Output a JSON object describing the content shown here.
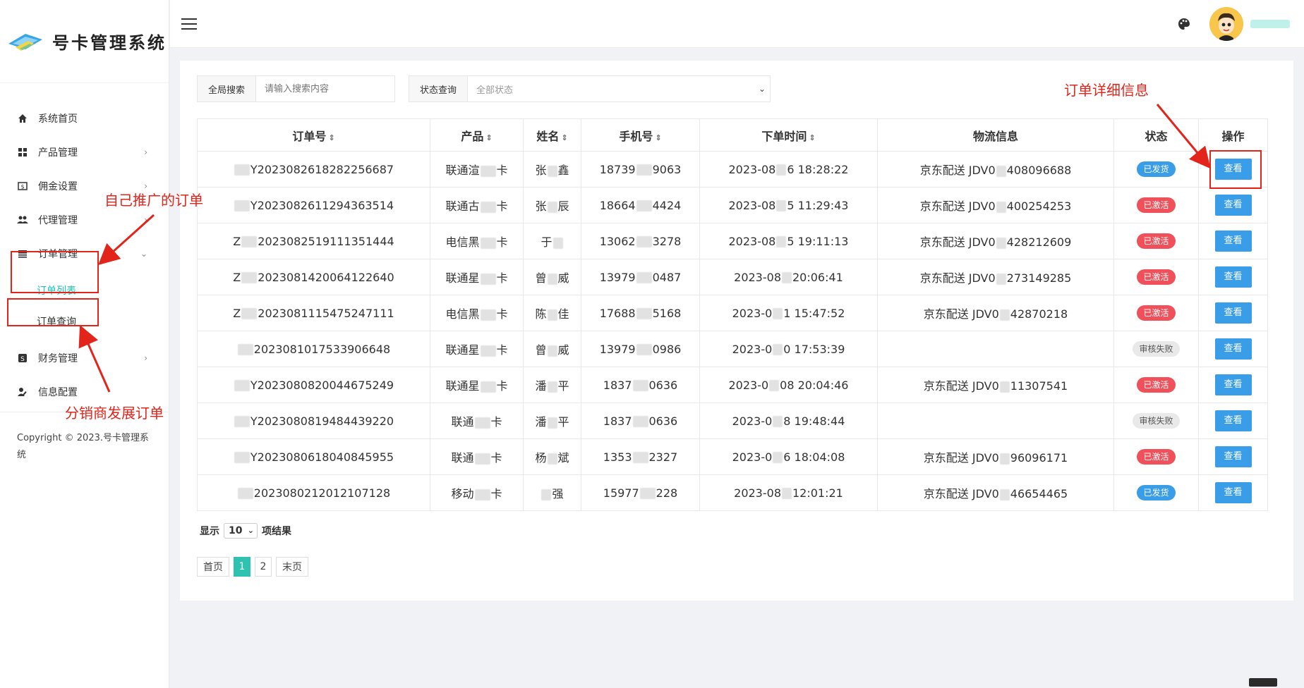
{
  "brand": {
    "title": "号卡管理系统"
  },
  "sidebar": {
    "items": [
      {
        "label": "系统首页",
        "icon": "home-icon"
      },
      {
        "label": "产品管理",
        "icon": "grid-icon"
      },
      {
        "label": "佣金设置",
        "icon": "dollar-icon"
      },
      {
        "label": "代理管理",
        "icon": "users-icon"
      },
      {
        "label": "订单管理",
        "icon": "list-icon"
      },
      {
        "label": "财务管理",
        "icon": "finance-icon"
      },
      {
        "label": "信息配置",
        "icon": "user-edit-icon"
      }
    ],
    "sub_items": [
      {
        "label": "订单列表",
        "active": true
      },
      {
        "label": "订单查询",
        "active": false
      }
    ],
    "copyright": "Copyright © 2023.号卡管理系统"
  },
  "filters": {
    "search_label": "全局搜索",
    "search_placeholder": "请输入搜索内容",
    "status_label": "状态查询",
    "status_value": "全部状态"
  },
  "table": {
    "headers": [
      "订单号",
      "产品",
      "姓名",
      "手机号",
      "下单时间",
      "物流信息",
      "状态",
      "操作"
    ],
    "rows": [
      {
        "order": [
          "",
          "Y2023082618282256687"
        ],
        "product": [
          "联通渲",
          "卡"
        ],
        "name": [
          "张",
          "鑫"
        ],
        "phone": [
          "18739",
          "9063"
        ],
        "time": [
          "2023-08",
          "6 18:28:22"
        ],
        "logistics": [
          "京东配送 JDV0",
          "408096688"
        ],
        "status": "已发货",
        "status_type": "blue",
        "action": "查看"
      },
      {
        "order": [
          "",
          "Y2023082611294363514"
        ],
        "product": [
          "联通古",
          "卡"
        ],
        "name": [
          "张",
          "辰"
        ],
        "phone": [
          "18664",
          "4424"
        ],
        "time": [
          "2023-08",
          "5 11:29:43"
        ],
        "logistics": [
          "京东配送 JDV0",
          "400254253"
        ],
        "status": "已激活",
        "status_type": "red",
        "action": "查看"
      },
      {
        "order": [
          "Z",
          "2023082519111351444"
        ],
        "product": [
          "电信黑",
          "卡"
        ],
        "name": [
          "于",
          ""
        ],
        "phone": [
          "13062",
          "3278"
        ],
        "time": [
          "2023-08",
          "5 19:11:13"
        ],
        "logistics": [
          "京东配送 JDV0",
          "428212609"
        ],
        "status": "已激活",
        "status_type": "red",
        "action": "查看"
      },
      {
        "order": [
          "Z",
          "2023081420064122640"
        ],
        "product": [
          "联通星",
          "卡"
        ],
        "name": [
          "曾",
          "威"
        ],
        "phone": [
          "13979",
          "0487"
        ],
        "time": [
          "2023-08",
          "20:06:41"
        ],
        "logistics": [
          "京东配送 JDV0",
          "273149285"
        ],
        "status": "已激活",
        "status_type": "red",
        "action": "查看"
      },
      {
        "order": [
          "Z",
          "2023081115475247111"
        ],
        "product": [
          "电信黑",
          "卡"
        ],
        "name": [
          "陈",
          "佳"
        ],
        "phone": [
          "17688",
          "5168"
        ],
        "time": [
          "2023-0",
          "1 15:47:52"
        ],
        "logistics": [
          "京东配送 JDV0",
          "42870218"
        ],
        "status": "已激活",
        "status_type": "red",
        "action": "查看"
      },
      {
        "order": [
          "",
          "2023081017533906648"
        ],
        "product": [
          "联通星",
          "卡"
        ],
        "name": [
          "曾",
          "威"
        ],
        "phone": [
          "13979",
          "0986"
        ],
        "time": [
          "2023-0",
          "0 17:53:39"
        ],
        "logistics": [
          "",
          ""
        ],
        "status": "审核失败",
        "status_type": "gray",
        "action": "查看"
      },
      {
        "order": [
          "",
          "Y2023080820044675249"
        ],
        "product": [
          "联通星",
          "卡"
        ],
        "name": [
          "潘",
          "平"
        ],
        "phone": [
          "1837",
          "0636"
        ],
        "time": [
          "2023-0",
          "08 20:04:46"
        ],
        "logistics": [
          "京东配送 JDV0",
          "11307541"
        ],
        "status": "已激活",
        "status_type": "red",
        "action": "查看"
      },
      {
        "order": [
          "",
          "Y2023080819484439220"
        ],
        "product": [
          "联通",
          "卡"
        ],
        "name": [
          "潘",
          "平"
        ],
        "phone": [
          "1837",
          "0636"
        ],
        "time": [
          "2023-0",
          "8 19:48:44"
        ],
        "logistics": [
          "",
          ""
        ],
        "status": "审核失败",
        "status_type": "gray",
        "action": "查看"
      },
      {
        "order": [
          "",
          "Y2023080618040845955"
        ],
        "product": [
          "联通",
          "卡"
        ],
        "name": [
          "杨",
          "斌"
        ],
        "phone": [
          "1353",
          "2327"
        ],
        "time": [
          "2023-0",
          "6 18:04:08"
        ],
        "logistics": [
          "京东配送 JDV0",
          "96096171"
        ],
        "status": "已激活",
        "status_type": "red",
        "action": "查看"
      },
      {
        "order": [
          "",
          "2023080212012107128"
        ],
        "product": [
          "移动",
          "卡"
        ],
        "name": [
          "",
          "强"
        ],
        "phone": [
          "15977",
          "228"
        ],
        "time": [
          "2023-08",
          "12:01:21"
        ],
        "logistics": [
          "京东配送 JDV0",
          "46654465"
        ],
        "status": "已发货",
        "status_type": "blue",
        "action": "查看"
      }
    ]
  },
  "pagination": {
    "show_label": "显示",
    "page_size": "10",
    "result_label": "项结果",
    "first": "首页",
    "pages": [
      "1",
      "2"
    ],
    "current": "1",
    "last": "末页"
  },
  "annotations": {
    "own_orders": "自己推广的订单",
    "distributor_orders": "分销商发展订单",
    "order_detail": "订单详细信息"
  },
  "colors": {
    "accent": "#1fc5b9",
    "primary_button": "#3a9de8",
    "badge_red": "#f0505a",
    "annotation": "#e2241b"
  }
}
